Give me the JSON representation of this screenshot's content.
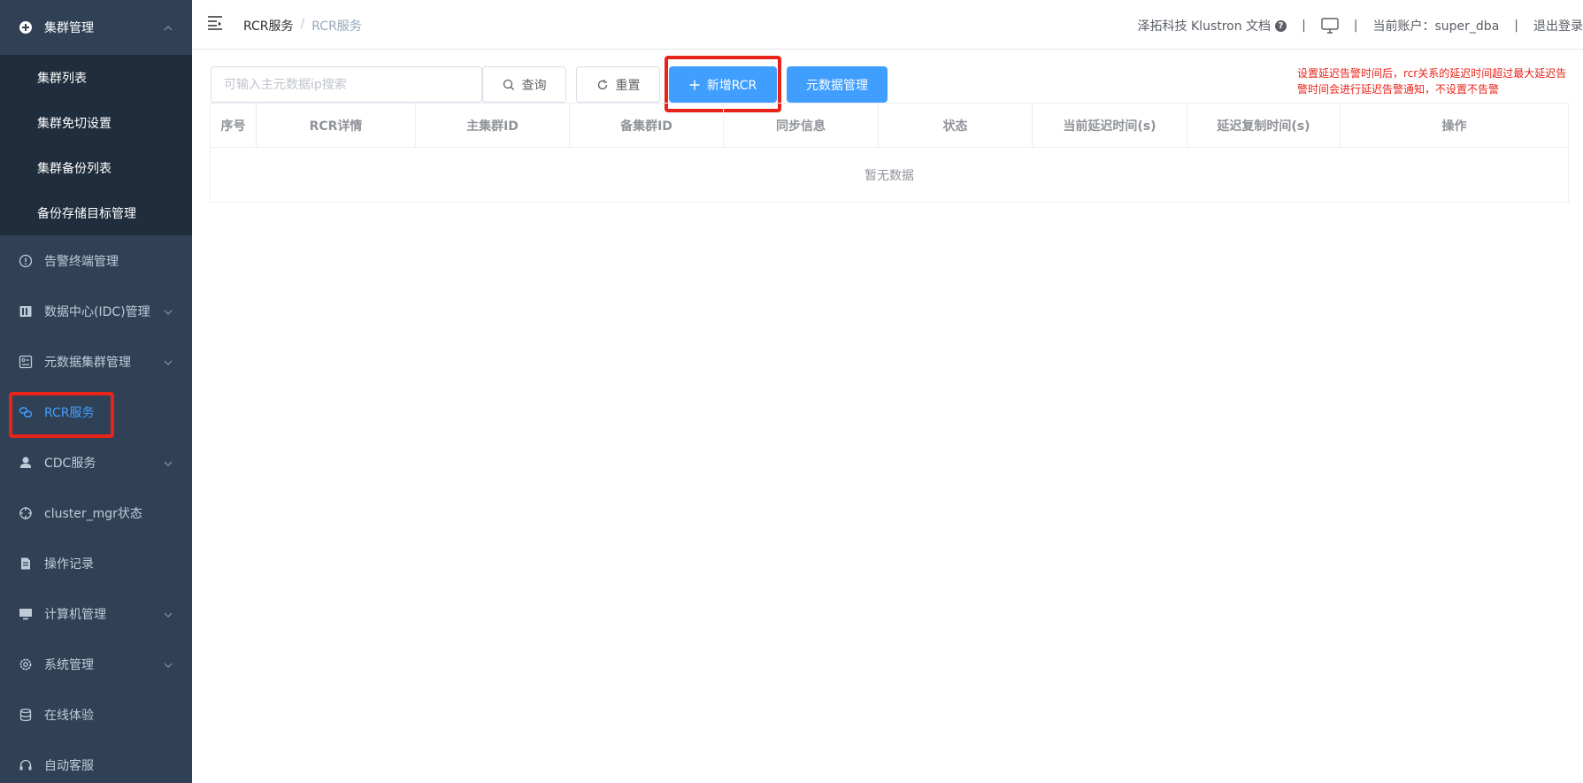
{
  "sidebar": {
    "groups": [
      {
        "label": "集群管理",
        "icon": "plus-circle-icon",
        "arrow": "chevron-up-icon"
      },
      {
        "label": "告警终端管理",
        "icon": "alert-circle-icon"
      },
      {
        "label": "数据中心(IDC)管理",
        "icon": "building-icon",
        "arrow": "chevron-down-icon"
      },
      {
        "label": "元数据集群管理",
        "icon": "database-panel-icon",
        "arrow": "chevron-down-icon"
      },
      {
        "label": "RCR服务",
        "icon": "link-icon",
        "active": true
      },
      {
        "label": "CDC服务",
        "icon": "user-icon",
        "arrow": "chevron-down-icon"
      },
      {
        "label": "cluster_mgr状态",
        "icon": "crosshair-icon"
      },
      {
        "label": "操作记录",
        "icon": "document-icon"
      },
      {
        "label": "计算机管理",
        "icon": "monitor-icon",
        "arrow": "chevron-down-icon"
      },
      {
        "label": "系统管理",
        "icon": "gear-icon",
        "arrow": "chevron-down-icon"
      },
      {
        "label": "在线体验",
        "icon": "stack-icon"
      },
      {
        "label": "自动客服",
        "icon": "headset-icon"
      }
    ],
    "submenu": [
      "集群列表",
      "集群免切设置",
      "集群备份列表",
      "备份存储目标管理"
    ]
  },
  "header": {
    "breadcrumb": [
      "RCR服务",
      "/",
      "RCR服务"
    ],
    "docs_link": "泽拓科技 Klustron 文档",
    "sep": "|",
    "account_label": "当前账户：super_dba",
    "logout": "退出登录"
  },
  "toolbar": {
    "search_placeholder": "可输入主元数据ip搜索",
    "query": "查询",
    "reset": "重置",
    "add_rcr": "新增RCR",
    "metadata_mgmt": "元数据管理",
    "notice": "设置延迟告警时间后，rcr关系的延迟时间超过最大延迟告警时间会进行延迟告警通知，不设置不告警"
  },
  "table": {
    "columns": [
      "序号",
      "RCR详情",
      "主集群ID",
      "备集群ID",
      "同步信息",
      "状态",
      "当前延迟时间(s)",
      "延迟复制时间(s)",
      "操作"
    ],
    "empty_text": "暂无数据"
  },
  "colors": {
    "sidebar_bg": "#304156",
    "submenu_bg": "#1f2d3d",
    "accent": "#409eff",
    "highlight": "#e8231a"
  }
}
